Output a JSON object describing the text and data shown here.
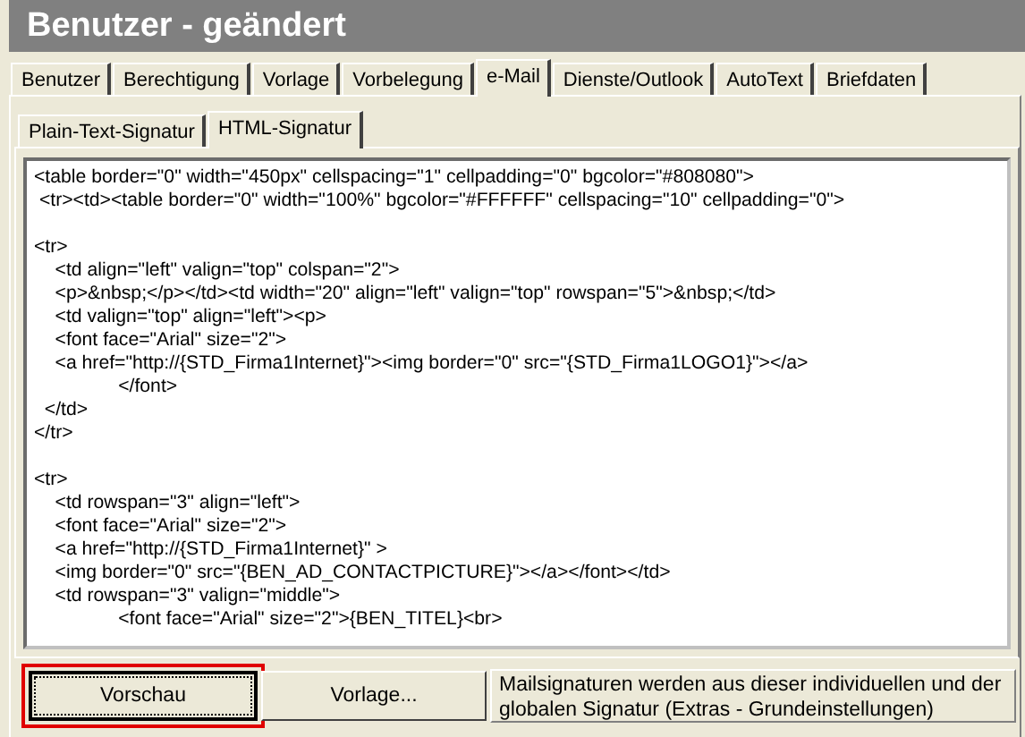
{
  "window": {
    "title": "Benutzer - geändert"
  },
  "tabs": [
    {
      "label": "Benutzer",
      "selected": false
    },
    {
      "label": "Berechtigung",
      "selected": false
    },
    {
      "label": "Vorlage",
      "selected": false
    },
    {
      "label": "Vorbelegung",
      "selected": false
    },
    {
      "label": "e-Mail",
      "selected": true
    },
    {
      "label": "Dienste/Outlook",
      "selected": false
    },
    {
      "label": "AutoText",
      "selected": false
    },
    {
      "label": "Briefdaten",
      "selected": false
    }
  ],
  "subtabs": [
    {
      "label": "Plain-Text-Signatur",
      "selected": false
    },
    {
      "label": "HTML-Signatur",
      "selected": true
    }
  ],
  "editor": {
    "value": "<table border=\"0\" width=\"450px\" cellspacing=\"1\" cellpadding=\"0\" bgcolor=\"#808080\">\n <tr><td><table border=\"0\" width=\"100%\" bgcolor=\"#FFFFFF\" cellspacing=\"10\" cellpadding=\"0\">\n\n<tr>\n    <td align=\"left\" valign=\"top\" colspan=\"2\">\n    <p>&nbsp;</p></td><td width=\"20\" align=\"left\" valign=\"top\" rowspan=\"5\">&nbsp;</td>\n    <td valign=\"top\" align=\"left\"><p>\n    <font face=\"Arial\" size=\"2\">\n    <a href=\"http://{STD_Firma1Internet}\"><img border=\"0\" src=\"{STD_Firma1LOGO1}\"></a>\n                </font>\n  </td>\n</tr>\n\n<tr>\n    <td rowspan=\"3\" align=\"left\">\n    <font face=\"Arial\" size=\"2\">\n    <a href=\"http://{STD_Firma1Internet}\" >\n    <img border=\"0\" src=\"{BEN_AD_CONTACTPICTURE}\"></a></font></td>\n    <td rowspan=\"3\" valign=\"middle\">\n                <font face=\"Arial\" size=\"2\">{BEN_TITEL}<br>"
  },
  "buttons": [
    {
      "label": "Vorschau",
      "highlighted": true
    },
    {
      "label": "Vorlage...",
      "highlighted": false
    }
  ],
  "note": "Mailsignaturen werden aus dieser individuellen und der globalen Signatur (Extras - Grundeinstellungen)"
}
